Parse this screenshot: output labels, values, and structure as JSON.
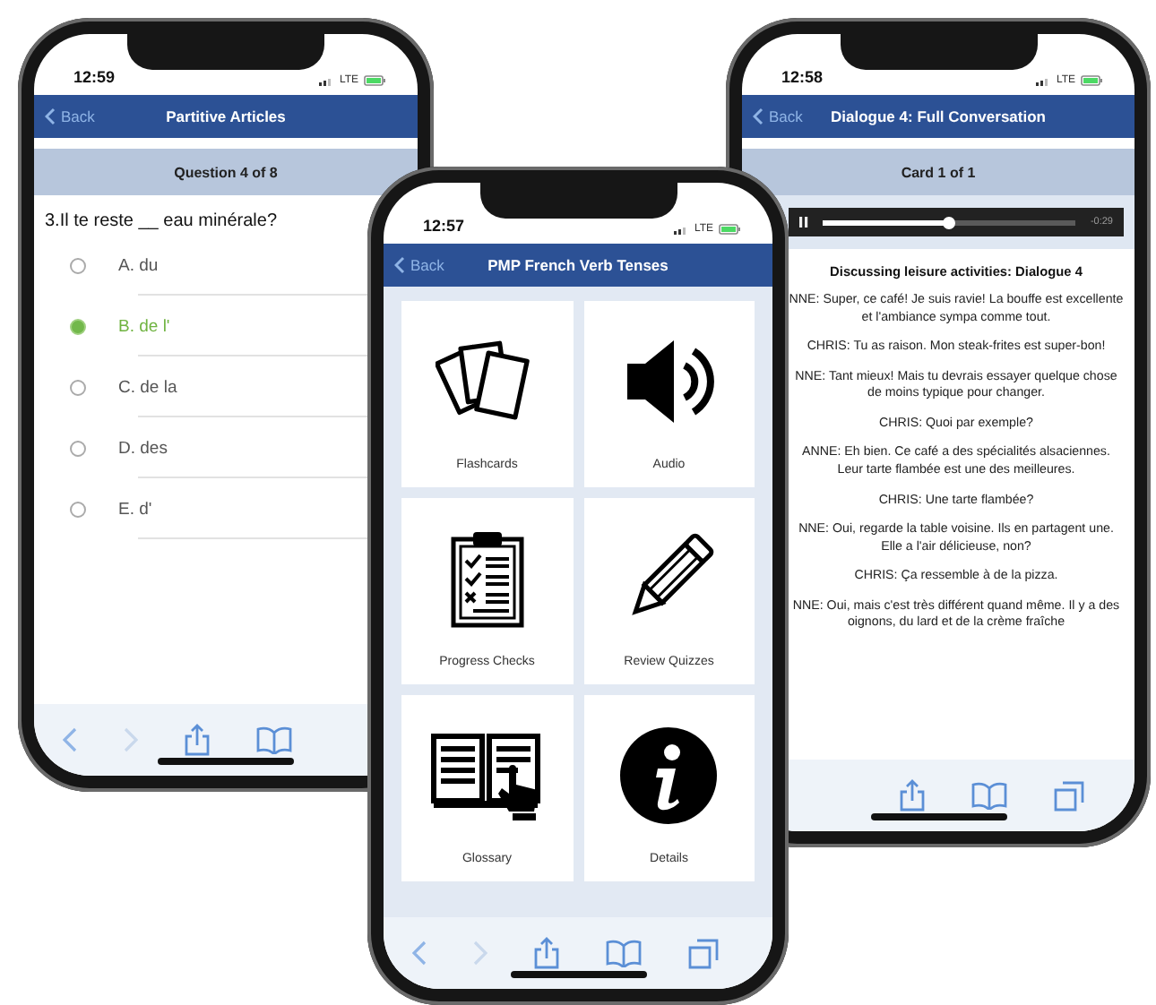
{
  "quiz_phone": {
    "status": {
      "time": "12:59",
      "network": "LTE"
    },
    "nav": {
      "back": "Back",
      "title": "Partitive Articles"
    },
    "header": "Question 4 of 8",
    "question": "3.Il te reste __ eau minérale?",
    "options": [
      {
        "label": "A. du",
        "selected": false
      },
      {
        "label": "B. de l'",
        "selected": true
      },
      {
        "label": "C. de la",
        "selected": false
      },
      {
        "label": "D. des",
        "selected": false
      },
      {
        "label": "E. d'",
        "selected": false
      }
    ]
  },
  "menu_phone": {
    "status": {
      "time": "12:57",
      "network": "LTE"
    },
    "nav": {
      "back": "Back",
      "title": "PMP French Verb Tenses"
    },
    "tiles": [
      {
        "kind": "cards",
        "label": "Flashcards"
      },
      {
        "kind": "speaker",
        "label": "Audio"
      },
      {
        "kind": "clipboard",
        "label": "Progress Checks"
      },
      {
        "kind": "pencil",
        "label": "Review Quizzes"
      },
      {
        "kind": "book",
        "label": "Glossary"
      },
      {
        "kind": "info",
        "label": "Details"
      }
    ]
  },
  "dialogue_phone": {
    "status": {
      "time": "12:58",
      "network": "LTE"
    },
    "nav": {
      "back": "Back",
      "title": "Dialogue 4: Full Conversation"
    },
    "header": "Card 1 of 1",
    "player": {
      "level": 0.5,
      "remaining": "-0:29"
    },
    "heading": "Discussing leisure activities: Dialogue 4",
    "lines": [
      "NNE: Super, ce café! Je suis ravie! La bouffe est excellente et l'ambiance sympa comme tout.",
      "CHRIS: Tu as raison. Mon steak-frites est super-bon!",
      "NNE: Tant mieux! Mais tu devrais essayer quelque chose de moins typique pour changer.",
      "CHRIS: Quoi par exemple?",
      "ANNE: Eh bien. Ce café a des spécialités alsaciennes. Leur tarte flambée est une des meilleures.",
      "CHRIS: Une tarte flambée?",
      "NNE: Oui, regarde la table voisine. Ils en partagent une. Elle a l'air délicieuse, non?",
      "CHRIS: Ça ressemble à de la pizza.",
      "NNE: Oui, mais c'est très différent quand même. Il y a des oignons, du lard et de la crème fraîche"
    ]
  }
}
